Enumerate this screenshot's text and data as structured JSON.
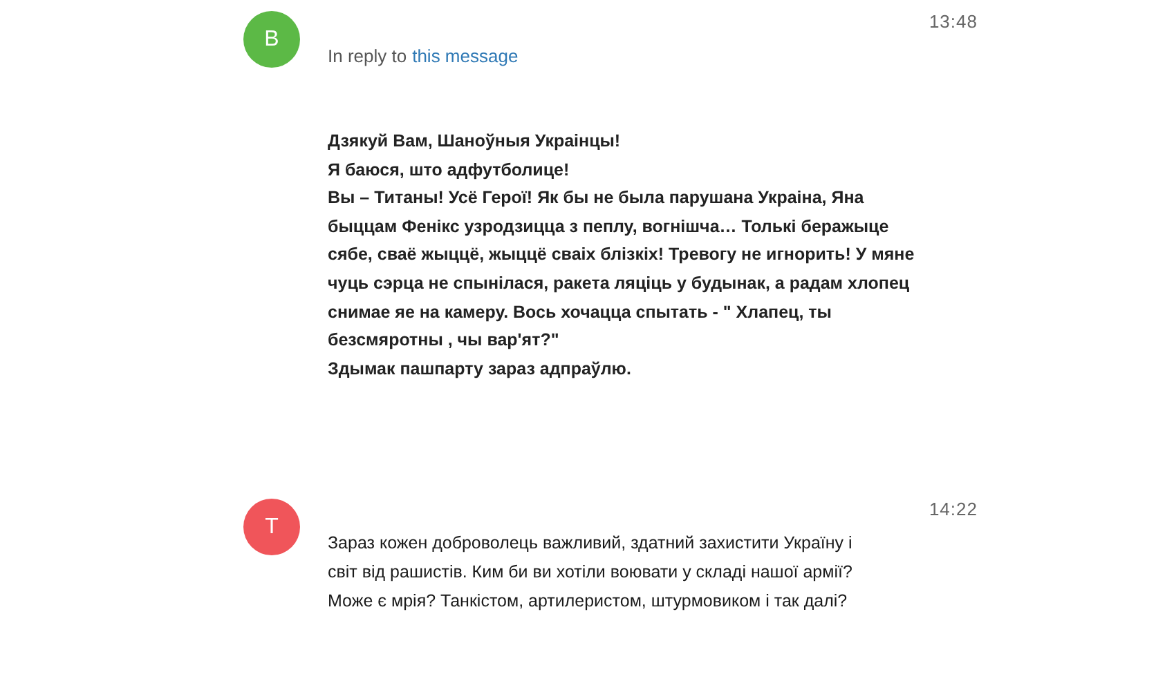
{
  "messages": [
    {
      "avatar": {
        "letter": "B",
        "color": "#5cb946"
      },
      "time": "13:48",
      "reply": {
        "prefix": "In reply to",
        "link": "this message"
      },
      "bold": true,
      "lines": [
        "Дзякуй Вам, Шаноўныя Украінцы!",
        "Я баюся, што адфутболице!",
        "Вы – Титаны! Усё Герої! Як бы не была парушана Украіна, Яна",
        "быццам Фенікс узродзицца з пеплу, вогнішча… Толькі беражыце",
        "сябе, сваё жыццё, жыццё сваіх блізкіх! Тревогу не игнорить! У мяне",
        "чуць сэрца не спынілася, ракета ляціць у будынак, а радам хлопец",
        "снимае яе на камеру. Вось хочацца спытать - \" Хлапец, ты",
        "безсмяротны , чы вар'ят?\"",
        "Здымак пашпарту зараз адпраўлю."
      ]
    },
    {
      "avatar": {
        "letter": "T",
        "color": "#f0555a"
      },
      "time": "14:22",
      "bold": false,
      "lines": [
        "Зараз кожен доброволець важливий, здатний захистити Україну і",
        "світ від рашистів. Ким би ви хотіли воювати у складі нашої армії?",
        "Може є мрія? Танкістом, артилеристом, штурмовиком і так далі?"
      ]
    }
  ]
}
